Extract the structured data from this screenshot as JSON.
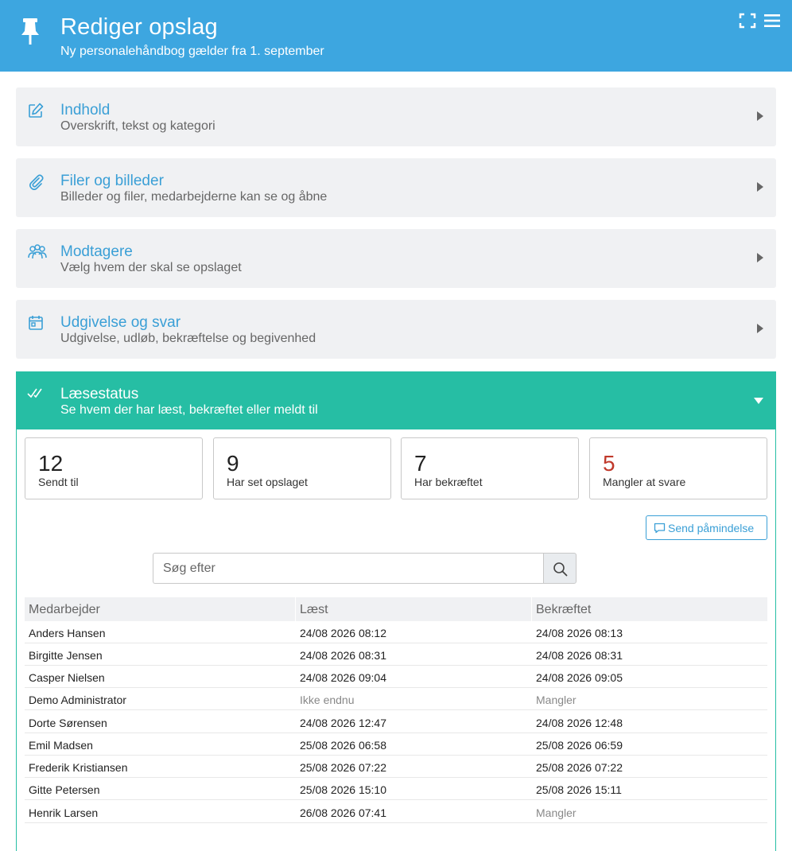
{
  "header": {
    "title": "Rediger opslag",
    "subtitle": "Ny personalehåndbog gælder fra 1. september",
    "icons": [
      "pin-icon",
      "fullscreen-icon",
      "menu-icon"
    ],
    "color": "#3da6e0"
  },
  "sections": [
    {
      "title": "Indhold",
      "subtitle": "Overskrift, tekst og kategori",
      "icon": "edit-icon"
    },
    {
      "title": "Filer og billeder",
      "subtitle": "Billeder og filer, medarbejderne kan se og åbne",
      "icon": "paperclip-icon"
    },
    {
      "title": "Modtagere",
      "subtitle": "Vælg hvem der skal se opslaget",
      "icon": "users-icon"
    },
    {
      "title": "Udgivelse og svar",
      "subtitle": "Udgivelse, udløb, bekræftelse og begivenhed",
      "icon": "calendar-icon"
    }
  ],
  "read_status": {
    "title": "Læsestatus",
    "subtitle": "Se hvem der har læst, bekræftet eller meldt til",
    "icon": "double-check-icon",
    "accent": "#26bea4",
    "stats": [
      {
        "value": "12",
        "label": "Sendt til"
      },
      {
        "value": "9",
        "label": "Har set opslaget"
      },
      {
        "value": "7",
        "label": "Har bekræftet"
      },
      {
        "value": "5",
        "label": "Mangler at svare",
        "color": "#c0392b"
      }
    ],
    "remind_button": "Send påmindelse",
    "search_placeholder": "Søg efter",
    "columns": [
      "Medarbejder",
      "Læst",
      "Bekræftet"
    ],
    "rows": [
      {
        "name": "Anders Hansen",
        "read": "24/08 2026 08:12",
        "confirmed": "24/08 2026 08:13"
      },
      {
        "name": "Birgitte Jensen",
        "read": "24/08 2026 08:31",
        "confirmed": "24/08 2026 08:31"
      },
      {
        "name": "Casper Nielsen",
        "read": "24/08 2026 09:04",
        "confirmed": "24/08 2026 09:05"
      },
      {
        "name": "Demo Administrator",
        "read": "Ikke endnu",
        "confirmed": "Mangler"
      },
      {
        "name": "Dorte Sørensen",
        "read": "24/08 2026 12:47",
        "confirmed": "24/08 2026 12:48"
      },
      {
        "name": "Emil Madsen",
        "read": "25/08 2026 06:58",
        "confirmed": "25/08 2026 06:59"
      },
      {
        "name": "Frederik Kristiansen",
        "read": "25/08 2026 07:22",
        "confirmed": "25/08 2026 07:22"
      },
      {
        "name": "Gitte Petersen",
        "read": "25/08 2026 15:10",
        "confirmed": "25/08 2026 15:11"
      },
      {
        "name": "Henrik Larsen",
        "read": "26/08 2026 07:41",
        "confirmed": "Mangler"
      }
    ]
  }
}
